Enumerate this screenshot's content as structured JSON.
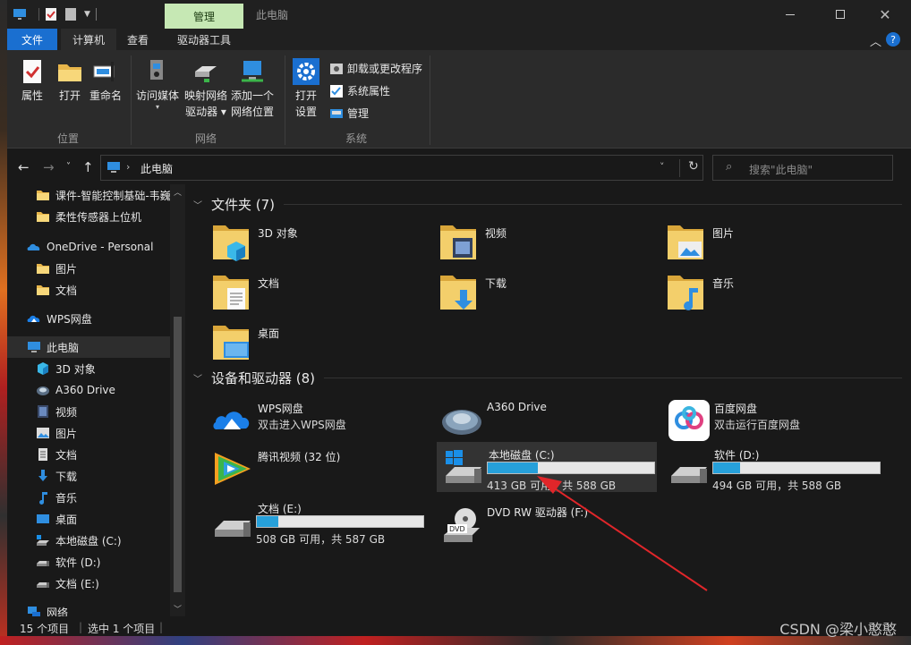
{
  "window": {
    "title": "此电脑",
    "context_tab": "管理"
  },
  "tabs": [
    "文件",
    "计算机",
    "查看",
    "驱动器工具"
  ],
  "ribbon": {
    "location": {
      "group": "位置",
      "items": [
        "属性",
        "打开",
        "重命名"
      ]
    },
    "network": {
      "group": "网络",
      "access_media": "访问媒体",
      "map_drive": [
        "映射网络",
        "驱动器"
      ],
      "add_location": [
        "添加一个",
        "网络位置"
      ]
    },
    "system": {
      "group": "系统",
      "open_settings": [
        "打开",
        "设置"
      ],
      "uninstall": "卸载或更改程序",
      "sys_props": "系统属性",
      "manage": "管理"
    }
  },
  "address": {
    "path": "此电脑",
    "search_placeholder": "搜索\"此电脑\""
  },
  "sidebar": [
    {
      "label": "课件-智能控制基础-韦巍",
      "icon": "folder-icon",
      "indent": 1
    },
    {
      "label": "柔性传感器上位机",
      "icon": "folder-icon",
      "indent": 1
    },
    {
      "label": "OneDrive - Personal",
      "icon": "onedrive-icon",
      "indent": 0
    },
    {
      "label": "图片",
      "icon": "folder-icon",
      "indent": 1
    },
    {
      "label": "文档",
      "icon": "folder-icon",
      "indent": 1
    },
    {
      "label": "WPS网盘",
      "icon": "wps-cloud-icon",
      "indent": 0
    },
    {
      "label": "此电脑",
      "icon": "pc-icon",
      "indent": 0,
      "selected": true
    },
    {
      "label": "3D 对象",
      "icon": "3d-objects-icon",
      "indent": 1
    },
    {
      "label": "A360 Drive",
      "icon": "a360-icon",
      "indent": 1
    },
    {
      "label": "视频",
      "icon": "video-icon",
      "indent": 1
    },
    {
      "label": "图片",
      "icon": "pictures-icon",
      "indent": 1
    },
    {
      "label": "文档",
      "icon": "documents-icon",
      "indent": 1
    },
    {
      "label": "下载",
      "icon": "download-icon",
      "indent": 1
    },
    {
      "label": "音乐",
      "icon": "music-icon",
      "indent": 1
    },
    {
      "label": "桌面",
      "icon": "desktop-icon",
      "indent": 1
    },
    {
      "label": "本地磁盘 (C:)",
      "icon": "drive-c-icon",
      "indent": 1
    },
    {
      "label": "软件 (D:)",
      "icon": "drive-icon",
      "indent": 1
    },
    {
      "label": "文档 (E:)",
      "icon": "drive-icon",
      "indent": 1
    },
    {
      "label": "网络",
      "icon": "network-icon",
      "indent": 0
    }
  ],
  "folders_section": "文件夹 (7)",
  "folders": [
    {
      "label": "3D 对象",
      "icon": "3d-objects-folder-icon"
    },
    {
      "label": "视频",
      "icon": "video-folder-icon"
    },
    {
      "label": "图片",
      "icon": "pictures-folder-icon"
    },
    {
      "label": "文档",
      "icon": "documents-folder-icon"
    },
    {
      "label": "下载",
      "icon": "download-folder-icon"
    },
    {
      "label": "音乐",
      "icon": "music-folder-icon"
    },
    {
      "label": "桌面",
      "icon": "desktop-folder-icon"
    }
  ],
  "devices_section": "设备和驱动器 (8)",
  "devices": {
    "wps": {
      "name": "WPS网盘",
      "sub": "双击进入WPS网盘"
    },
    "a360": {
      "name": "A360 Drive"
    },
    "baidu": {
      "name": "百度网盘",
      "sub": "双击运行百度网盘"
    },
    "tencent": {
      "name": "腾讯视频 (32 位)"
    },
    "c": {
      "name": "本地磁盘 (C:)",
      "free": "413 GB 可用，共 588 GB",
      "used_fraction": 0.3
    },
    "d": {
      "name": "软件 (D:)",
      "free": "494 GB 可用，共 588 GB",
      "used_fraction": 0.16
    },
    "e": {
      "name": "文档 (E:)",
      "free": "508 GB 可用，共 587 GB",
      "used_fraction": 0.13
    },
    "dvd": {
      "name": "DVD RW 驱动器 (F:)"
    }
  },
  "status": {
    "count": "15 个项目",
    "selected": "选中 1 个项目"
  },
  "watermark": "CSDN @梁小憨憨",
  "colors": {
    "file_tab": "#1a6fd0",
    "manage_tab": "#c6e8b4",
    "progress": "#26a0da",
    "arrow": "#e0262a"
  }
}
